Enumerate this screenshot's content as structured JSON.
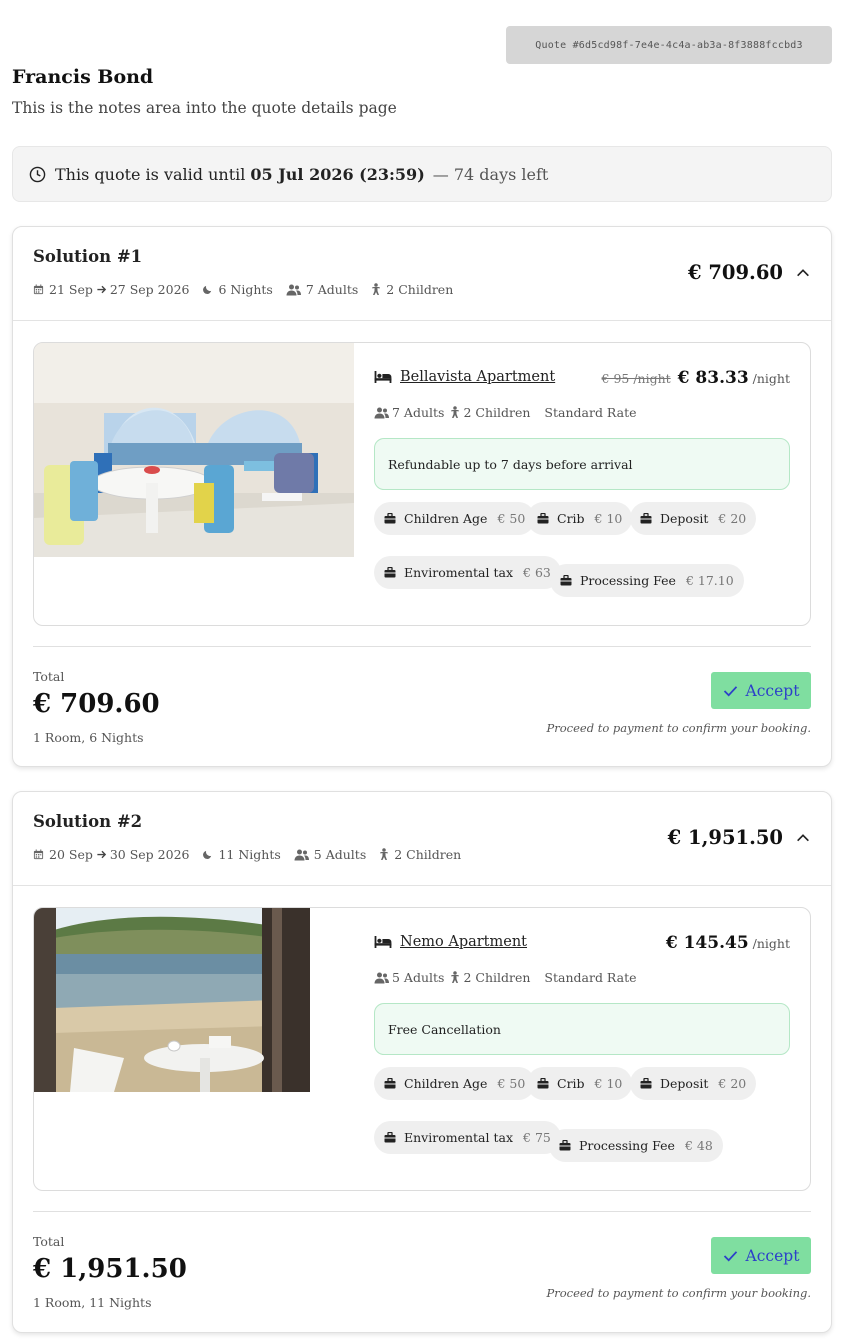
{
  "quote_id": "Quote #6d5cd98f-7e4e-4c4a-ab3a-8f3888fccbd3",
  "customer_name": "Francis Bond",
  "notes": "This is the notes area into the quote details page",
  "validity": {
    "prefix": "This quote is valid until",
    "date": "05 Jul 2026 (23:59)",
    "days_left": "— 74 days left"
  },
  "colors": {
    "accept_bg": "#7fdea0",
    "accept_text": "#2d3fc9",
    "policy_bg": "#effaf3",
    "policy_border": "#b5e7c6"
  },
  "solutions": [
    {
      "title": "Solution #1",
      "check_in": "21 Sep",
      "check_out": "27 Sep 2026",
      "nights": "6 Nights",
      "adults": "7 Adults",
      "children": "2 Children",
      "price": "€ 709.60",
      "room": {
        "name": "Bellavista Apartment",
        "old_price": "€ 95 /night",
        "price": "€ 83.33",
        "per": "/night",
        "adults": "7 Adults",
        "children": "2 Children",
        "rate": "Standard Rate",
        "policy": "Refundable up to 7 days before arrival",
        "image": "terrace with white table and chairs, arched windows, sea view",
        "extras": [
          {
            "label": "Children Age",
            "amount": "€ 50"
          },
          {
            "label": "Crib",
            "amount": "€ 10"
          },
          {
            "label": "Deposit",
            "amount": "€ 20"
          },
          {
            "label": "Enviromental tax",
            "amount": "€ 63"
          },
          {
            "label": "Processing Fee",
            "amount": "€ 17.10"
          }
        ]
      },
      "total_label": "Total",
      "total": "€ 709.60",
      "total_sub": "1 Room, 6 Nights",
      "accept_label": "Accept",
      "proceed": "Proceed to payment to confirm your booking."
    },
    {
      "title": "Solution #2",
      "check_in": "20 Sep",
      "check_out": "30 Sep 2026",
      "nights": "11 Nights",
      "adults": "5 Adults",
      "children": "2 Children",
      "price": "€ 1,951.50",
      "room": {
        "name": "Nemo Apartment",
        "price": "€ 145.45",
        "per": "/night",
        "adults": "5 Adults",
        "children": "2 Children",
        "rate": "Standard Rate",
        "policy": "Free Cancellation",
        "image": "beach view through doorway with white table and chair",
        "extras": [
          {
            "label": "Children Age",
            "amount": "€ 50"
          },
          {
            "label": "Crib",
            "amount": "€ 10"
          },
          {
            "label": "Deposit",
            "amount": "€ 20"
          },
          {
            "label": "Enviromental tax",
            "amount": "€ 75"
          },
          {
            "label": "Processing Fee",
            "amount": "€ 48"
          }
        ]
      },
      "total_label": "Total",
      "total": "€ 1,951.50",
      "total_sub": "1 Room, 11 Nights",
      "accept_label": "Accept",
      "proceed": "Proceed to payment to confirm your booking."
    }
  ]
}
